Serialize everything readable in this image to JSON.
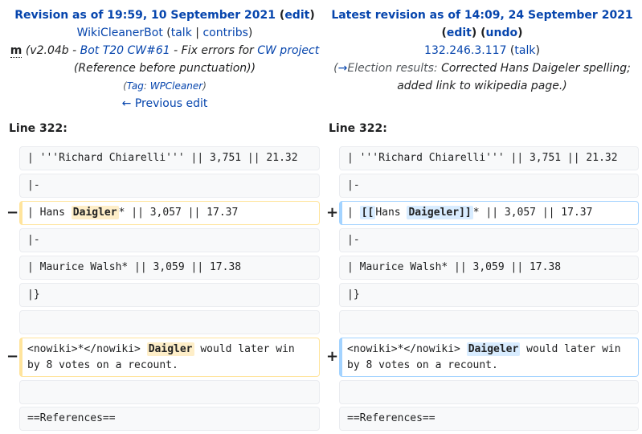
{
  "left": {
    "title_prefix": "Revision as of 19:59, 10 September 2021",
    "edit_label": "edit",
    "user": "WikiCleanerBot",
    "talk": "talk",
    "contribs": "contribs",
    "minor": "m",
    "summary_ver": "(v2.04b - ",
    "summary_link1": "Bot T20 CW#61",
    "summary_mid": " - Fix errors for ",
    "summary_link2": "CW project",
    "summary_end": " (Reference before punctuation))",
    "tag_prefix": "Tag",
    "tag_name": "WPCleaner",
    "prev_edit": "← Previous edit",
    "line_no": "Line 322:"
  },
  "right": {
    "title_prefix": "Latest revision as of 14:09, 24 September 2021",
    "edit_label": "edit",
    "undo_label": "undo",
    "user": "132.246.3.117",
    "talk": "talk",
    "section_arrow": "→",
    "section_name": "Election results:",
    "summary": " Corrected Hans Daigeler spelling; added link to wikipedia page.)",
    "line_no": "Line 322:"
  },
  "diff": {
    "rows": [
      {
        "left": "| '''Richard Chiarelli''' || 3,751 || 21.32",
        "right": "| '''Richard Chiarelli''' || 3,751 || 21.32"
      },
      {
        "left": "|-",
        "right": "|-"
      },
      {
        "left_pre": "| Hans ",
        "left_chg": "Daigler",
        "left_post": "* || 3,057 || 17.37",
        "right_pre": "| ",
        "right_chg1": "[[",
        "right_mid": "Hans ",
        "right_chg2": "Daigeler]]",
        "right_post": "* || 3,057 || 17.37"
      },
      {
        "left": "|-",
        "right": "|-"
      },
      {
        "left": "| Maurice Walsh* || 3,059 || 17.38",
        "right": "| Maurice Walsh* || 3,059 || 17.38"
      },
      {
        "left": "|}",
        "right": "|}"
      },
      {
        "left": "",
        "right": ""
      },
      {
        "left_pre": "<nowiki>*</nowiki> ",
        "left_chg": "Daigler",
        "left_post": " would later win by 8 votes on a recount.",
        "right_pre": "<nowiki>*</nowiki> ",
        "right_chg": "Daigeler",
        "right_post": " would later win by 8 votes on a recount."
      },
      {
        "left": "",
        "right": ""
      },
      {
        "left": "==References==",
        "right": "==References=="
      }
    ],
    "del_marker": "−",
    "add_marker": "+"
  }
}
